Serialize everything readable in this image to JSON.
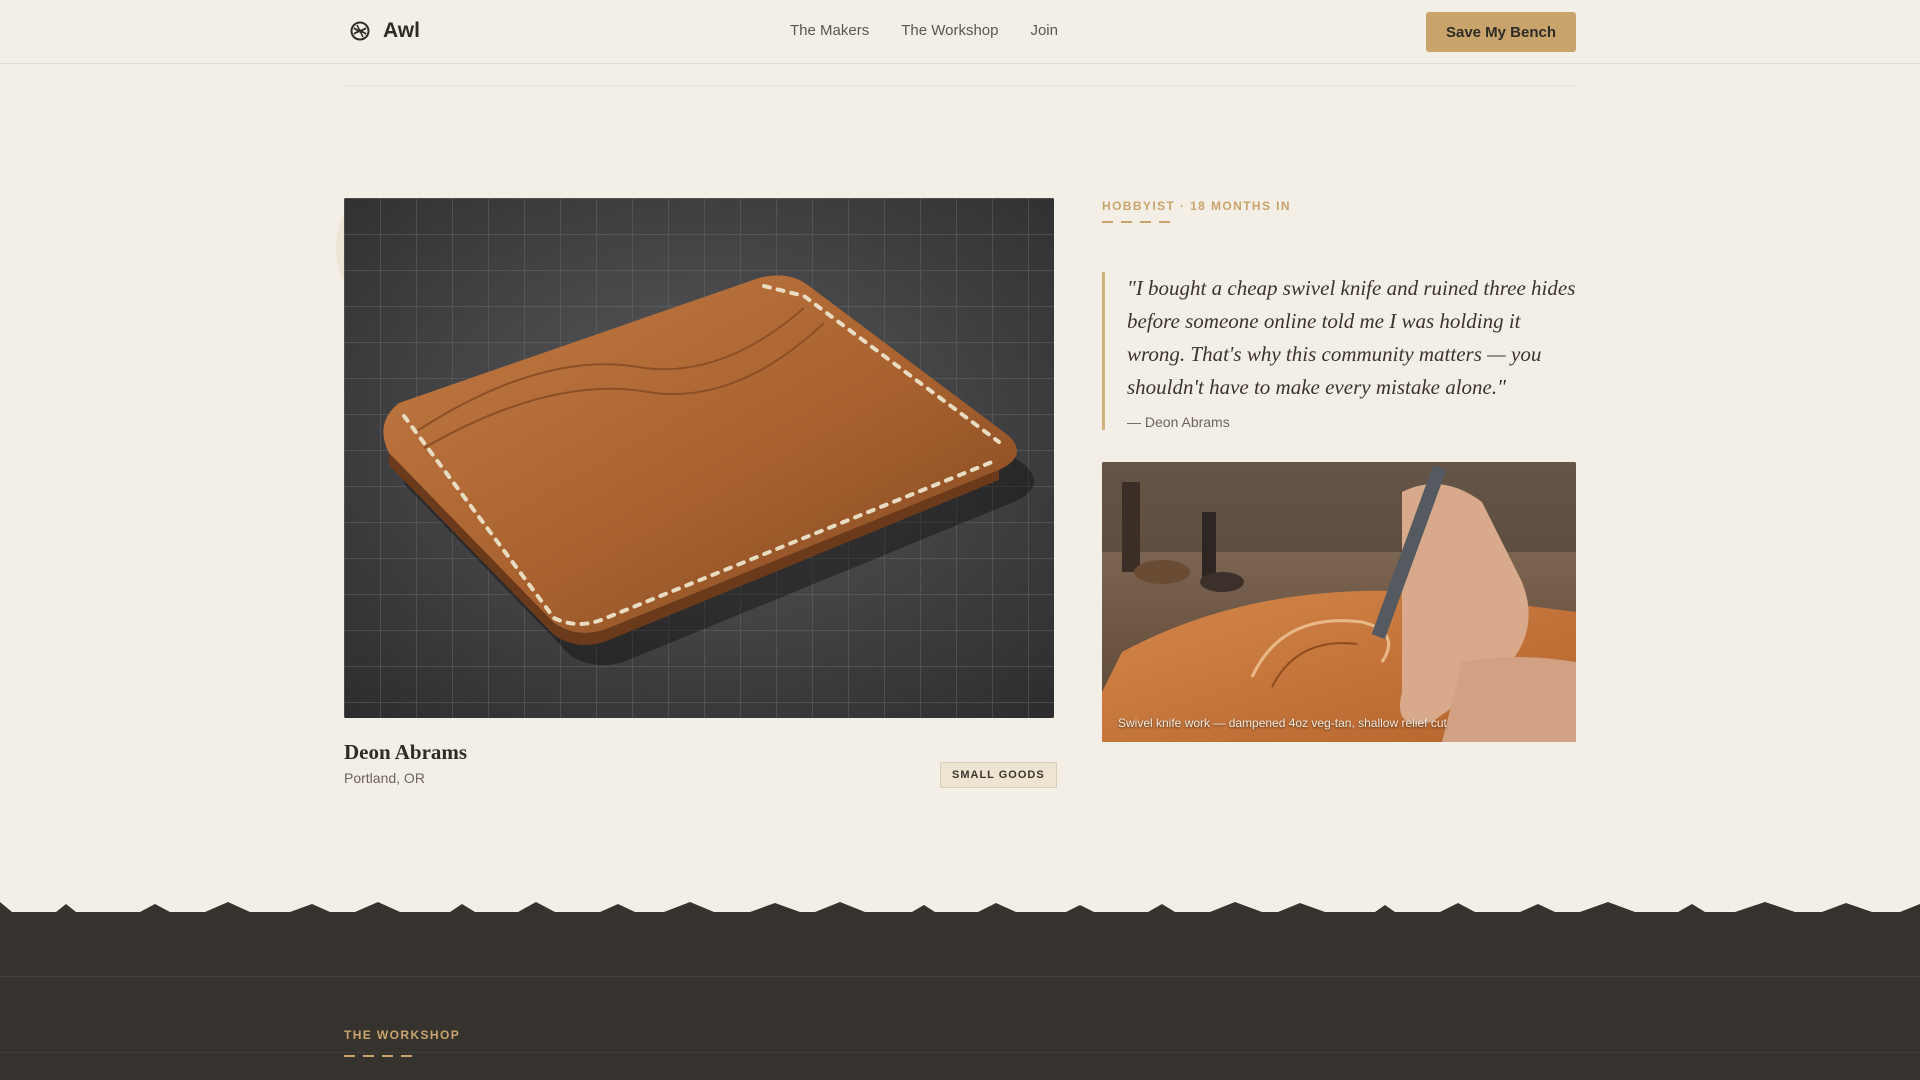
{
  "brand": {
    "name": "Awl",
    "icon": "knot-logo-icon"
  },
  "nav": {
    "items": [
      "The Makers",
      "The Workshop",
      "Join"
    ]
  },
  "cta": {
    "label": "Save My Bench"
  },
  "maker": {
    "name": "Deon Abrams",
    "location": "Portland, OR",
    "tag": "SMALL GOODS",
    "eyebrow": "HOBBYIST · 18 MONTHS IN",
    "quote": "\"I bought a cheap swivel knife and ruined three hides before someone online told me I was holding it wrong. That's why this community matters — you shouldn't have to make every mistake alone.\"",
    "attribution": "— Deon Abrams",
    "photo_caption": "Swivel knife work — dampened 4oz veg-tan, shallow relief cut"
  },
  "workshop": {
    "title": "THE WORKSHOP"
  },
  "colors": {
    "background": "#f4efe6",
    "accent": "#c8a46c",
    "dark_band": "#36332f",
    "text": "#2f2b27"
  }
}
